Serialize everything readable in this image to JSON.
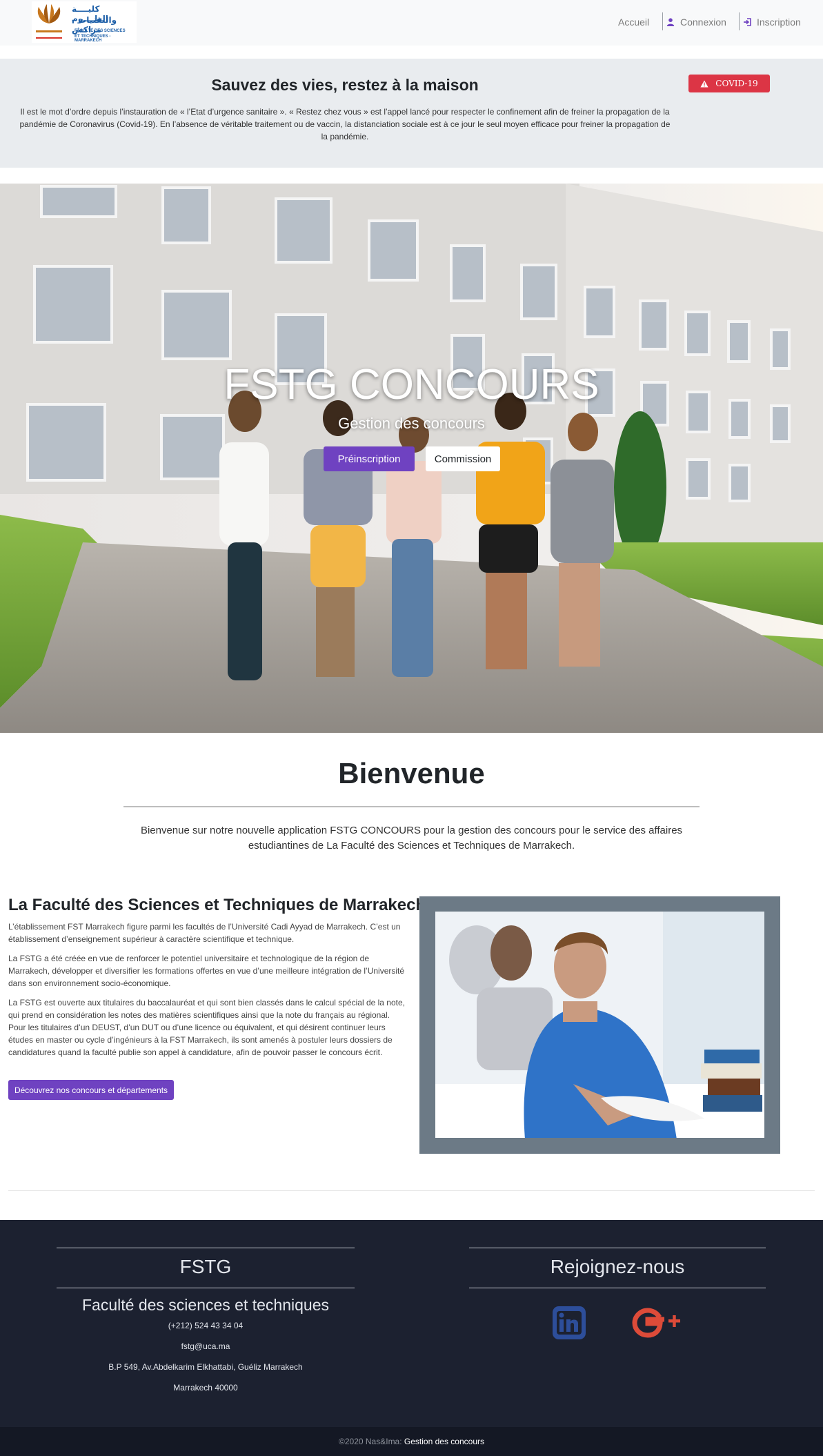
{
  "navbar": {
    "logo": {
      "arabic_line1": "كليــــة العلــــوم",
      "arabic_line2": "والتقنيات - مراكش",
      "french_line1": "FACULTÉ DES SCIENCES",
      "french_line2": "ET TECHNIQUES - MARRAKECH",
      "mark_text": "MARRAKECH"
    },
    "links": [
      {
        "label": "Accueil",
        "icon": ""
      },
      {
        "label": "Connexion",
        "icon": "user-icon"
      },
      {
        "label": "Inscription",
        "icon": "sign-in-icon"
      }
    ]
  },
  "covid": {
    "title": "Sauvez des vies, restez à la maison",
    "text": "Il est le mot d’ordre depuis l’instauration de « l’Etat d’urgence sanitaire ». « Restez chez vous » est l’appel lancé pour respecter le confinement afin de freiner la propagation de la pandémie de Coronavirus (Covid-19). En l’absence de véritable traitement ou de vaccin, la distanciation sociale est à ce jour le seul moyen efficace pour freiner la propagation de la pandémie.",
    "badge": "COVID-19"
  },
  "hero": {
    "title": "FSTG CONCOURS",
    "subtitle": "Gestion des concours",
    "primary_button": "Préinscription",
    "secondary_button": "Commission"
  },
  "welcome": {
    "title": "Bienvenue",
    "text": "Bienvenue sur notre nouvelle application FSTG CONCOURS pour la gestion des concours pour le service des affaires estudiantines de La Faculté des Sciences et Techniques de Marrakech."
  },
  "faculty": {
    "title": "La Faculté des Sciences et Techniques de Marrakech",
    "paragraphs": [
      "L’établissement FST Marrakech figure parmi les facultés de l’Université Cadi Ayyad de Marrakech. C’est un établissement d’enseignement supérieur à caractère scientifique et technique.",
      "La FSTG a été créée en vue de renforcer le potentiel universitaire et technologique de la région de Marrakech, développer et diversifier les formations offertes en vue d’une meilleure intégration de l’Université dans son environnement socio-économique.",
      "La FSTG est ouverte aux titulaires du baccalauréat et qui sont bien classés dans le calcul spécial de la note, qui prend en considération les notes des matières scientifiques ainsi que la note du français au régional. Pour les titulaires d’un DEUST, d’un DUT ou d’une licence ou équivalent, et qui désirent continuer leurs études en master ou cycle d’ingénieurs à la FST Marrakech, ils sont amenés à postuler leurs dossiers de candidatures quand la faculté publie son appel à candidature, afin de pouvoir passer le concours écrit."
    ],
    "button": "Découvrez nos concours et départements"
  },
  "footer": {
    "left_title": "FSTG",
    "left_subtitle": "Faculté des sciences et techniques",
    "phone": "(+212) 524 43 34 04",
    "email": "fstg@uca.ma",
    "address": "B.P 549, Av.Abdelkarim Elkhattabi, Guéliz Marrakech",
    "city": "Marrakech 40000",
    "right_title": "Rejoignez-nous",
    "social": [
      {
        "icon": "linkedin-icon",
        "color": "#2d4e9a"
      },
      {
        "icon": "google-plus-icon",
        "color": "#dd4b39"
      }
    ]
  },
  "bottom": {
    "copyright": "©2020 Nas&Ima:",
    "app_name": "Gestion des concours"
  },
  "colors": {
    "accent": "#6f42c1",
    "danger": "#dc3545",
    "footer_bg": "#1c2130"
  }
}
